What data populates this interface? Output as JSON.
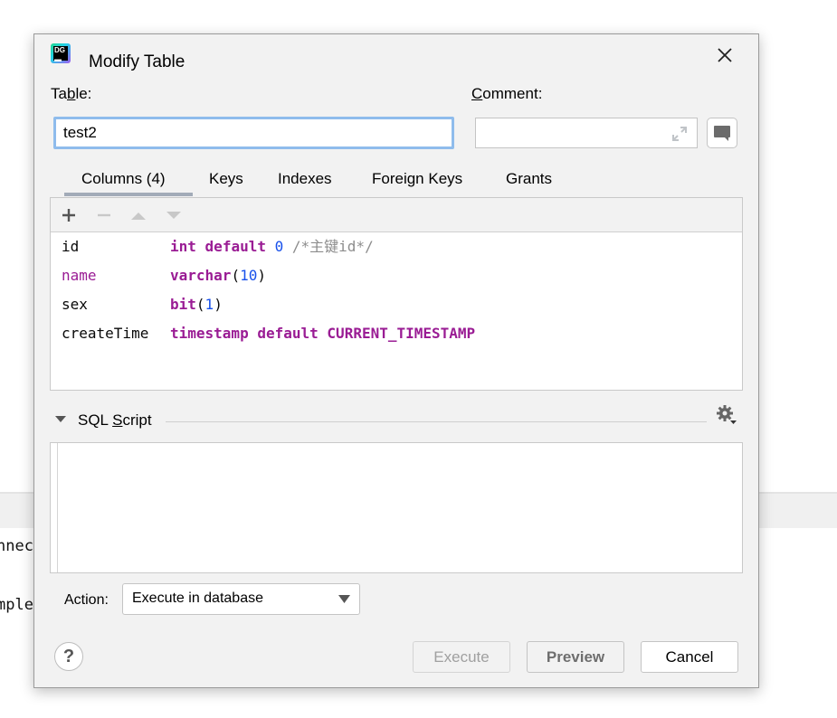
{
  "background": {
    "fragments": [
      "nnec",
      "mple"
    ]
  },
  "dialog": {
    "title": "Modify Table",
    "logo_text": "DG",
    "table_label_pre": "Ta",
    "table_label_u": "b",
    "table_label_post": "le:",
    "table_value": "test2",
    "comment_label_u": "C",
    "comment_label_post": "omment:",
    "comment_value": "",
    "tabs": [
      {
        "label": "Columns (4)",
        "selected": true
      },
      {
        "label": "Keys"
      },
      {
        "label": "Indexes"
      },
      {
        "label": "Foreign Keys"
      },
      {
        "label": "Grants"
      }
    ],
    "columns": [
      {
        "name": "id",
        "name_kind": "plain",
        "tokens": [
          {
            "t": "int",
            "k": "keyword"
          },
          {
            "t": " ",
            "k": "plain"
          },
          {
            "t": "default",
            "k": "keyword"
          },
          {
            "t": " ",
            "k": "plain"
          },
          {
            "t": "0",
            "k": "number"
          },
          {
            "t": " /*主键id*/",
            "k": "comment"
          }
        ]
      },
      {
        "name": "name",
        "name_kind": "ident",
        "tokens": [
          {
            "t": "varchar",
            "k": "keyword"
          },
          {
            "t": "(",
            "k": "punct"
          },
          {
            "t": "10",
            "k": "number"
          },
          {
            "t": ")",
            "k": "punct"
          }
        ]
      },
      {
        "name": "sex",
        "name_kind": "plain",
        "tokens": [
          {
            "t": "bit",
            "k": "keyword"
          },
          {
            "t": "(",
            "k": "punct"
          },
          {
            "t": "1",
            "k": "number"
          },
          {
            "t": ")",
            "k": "punct"
          }
        ]
      },
      {
        "name": "createTime",
        "name_kind": "plain",
        "tokens": [
          {
            "t": "timestamp",
            "k": "keyword"
          },
          {
            "t": " ",
            "k": "plain"
          },
          {
            "t": "default",
            "k": "keyword"
          },
          {
            "t": " ",
            "k": "plain"
          },
          {
            "t": "CURRENT_TIMESTAMP",
            "k": "keyword"
          }
        ]
      }
    ],
    "sql_label_pre": "SQL ",
    "sql_label_u": "S",
    "sql_label_post": "cript",
    "sql_content": "",
    "action_label": "Action:",
    "action_value": "Execute in database",
    "buttons": {
      "help": "?",
      "execute": "Execute",
      "preview": "Preview",
      "cancel": "Cancel"
    },
    "colors": {
      "keyword": "#9a1c94",
      "number": "#1750eb",
      "comment": "#8c8c8c",
      "focus_border": "#8fbcec"
    }
  }
}
